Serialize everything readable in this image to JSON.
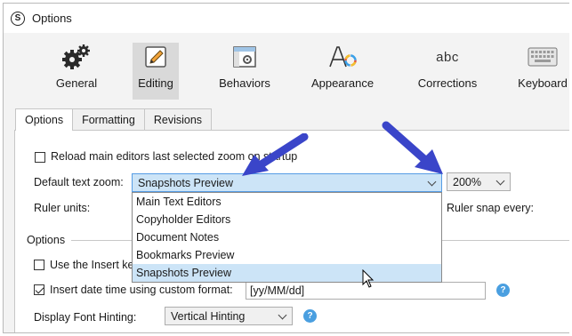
{
  "window": {
    "title": "Options"
  },
  "toolbar": {
    "items": [
      {
        "label": "General"
      },
      {
        "label": "Editing"
      },
      {
        "label": "Behaviors"
      },
      {
        "label": "Appearance"
      },
      {
        "label": "Corrections"
      },
      {
        "label": "Keyboard"
      }
    ],
    "corrections_icon_text": "abc",
    "selected": "Editing"
  },
  "tabs": [
    "Options",
    "Formatting",
    "Revisions"
  ],
  "active_tab": "Options",
  "form": {
    "reload_checkbox_label": "Reload main editors last selected zoom on startup",
    "reload_checked": false,
    "default_zoom_label": "Default text zoom:",
    "default_zoom_value": "Snapshots Preview",
    "zoom_percent_value": "200%",
    "ruler_units_label": "Ruler units:",
    "ruler_snap_label": "Ruler snap every:",
    "options_section_label": "Options",
    "use_insert_label": "Use the Insert ke",
    "use_insert_checked": false,
    "insert_date_label": "Insert date time using custom format:",
    "insert_date_checked": true,
    "date_format_value": "[yy/MM/dd]",
    "font_hinting_label": "Display Font Hinting:",
    "font_hinting_value": "Vertical Hinting"
  },
  "dropdown": {
    "options": [
      "Main Text Editors",
      "Copyholder Editors",
      "Document Notes",
      "Bookmarks Preview",
      "Snapshots Preview"
    ],
    "selected": "Snapshots Preview"
  },
  "colors": {
    "annotation_arrow": "#3a45c9",
    "selection": "#cce4f7",
    "help": "#4a9fe0"
  }
}
